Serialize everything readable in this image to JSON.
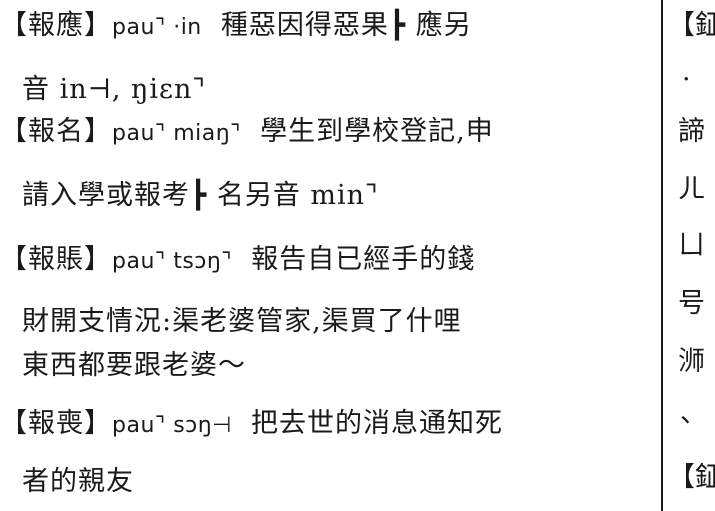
{
  "left_column": {
    "entries": [
      {
        "headword": "【報應】",
        "pron": "pau⌝ ·in",
        "def_line1": "種惡因得惡果┣ 應另",
        "continuation": "音 in⊣, ŋiɛn⌝"
      },
      {
        "headword": "【報名】",
        "pron": "pau⌝ miaŋ⌝",
        "def_line1": "學生到學校登記,申",
        "continuation": "請入學或報考┣ 名另音 min⌝"
      },
      {
        "headword": "【報賬】",
        "pron": "pau⌝ tsɔŋ⌝",
        "def_line1": "報告自已經手的錢",
        "continuation": "財開支情況:渠老婆管家,渠買了什哩",
        "continuation2": "東西都要跟老婆～"
      },
      {
        "headword": "【報喪】",
        "pron": "pau⌝ sɔŋ⊣",
        "def_line1": "把去世的消息通知死",
        "continuation": "者的親友"
      }
    ]
  },
  "right_column": {
    "fragments": [
      "【鉦",
      "·",
      "諦",
      "ㄦ",
      "ㄩ",
      "号",
      "浉",
      "、",
      "【鉦"
    ]
  }
}
